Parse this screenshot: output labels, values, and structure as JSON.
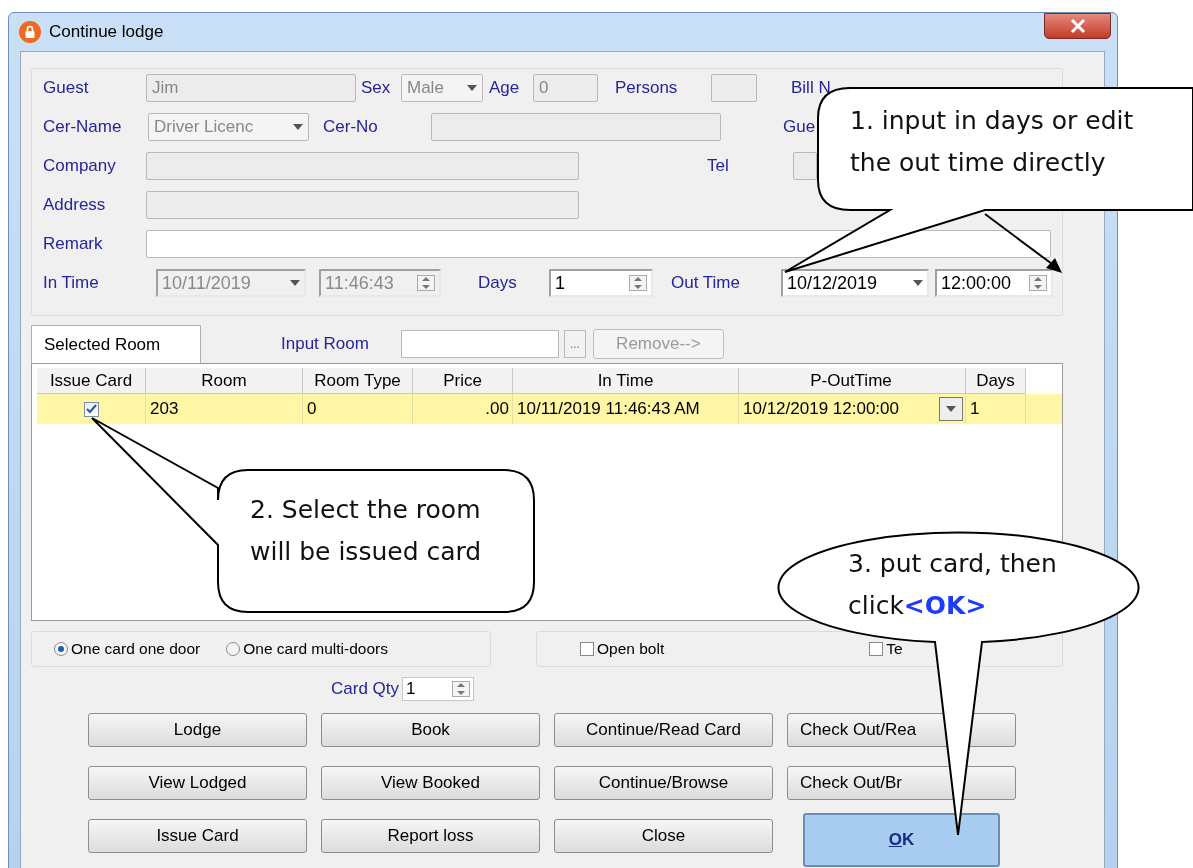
{
  "window": {
    "title": "Continue lodge"
  },
  "guest_info": {
    "guest": {
      "label": "Guest",
      "value": "Jim"
    },
    "sex": {
      "label": "Sex",
      "value": "Male"
    },
    "age": {
      "label": "Age",
      "value": "0"
    },
    "persons": {
      "label": "Persons"
    },
    "bill_no": {
      "label": "Bill N"
    },
    "cer_name": {
      "label": "Cer-Name",
      "value": "Driver Licenc"
    },
    "cer_no": {
      "label": "Cer-No"
    },
    "guest_2": {
      "label": "Gue"
    },
    "company": {
      "label": "Company"
    },
    "tel": {
      "label": "Tel"
    },
    "address": {
      "label": "Address"
    },
    "remark": {
      "label": "Remark"
    },
    "in_time": {
      "label": "In Time",
      "date": "10/11/2019",
      "time": "11:46:43"
    },
    "days": {
      "label": "Days",
      "value": "1"
    },
    "out_time": {
      "label": "Out Time",
      "date": "10/12/2019",
      "time": "12:00:00"
    }
  },
  "room_panel": {
    "tabs": [
      {
        "label": "Selected Room",
        "selected": true
      }
    ],
    "input_room": {
      "label": "Input Room"
    },
    "browse_button": "...",
    "remove_button": {
      "label": "Remove-->",
      "disabled": true
    },
    "table": {
      "columns": [
        "Issue Card",
        "Room",
        "Room Type",
        "Price",
        "In Time",
        "P-OutTime",
        "Days"
      ],
      "rows": [
        {
          "issue_card": true,
          "selected": true,
          "cells": [
            "",
            "203",
            "0",
            ".00",
            "10/11/2019 11:46:43 AM",
            "10/12/2019 12:00:00",
            "1"
          ]
        }
      ]
    }
  },
  "card_mode": [
    {
      "label": "One card one door",
      "selected": true
    },
    {
      "label": "One card multi-doors",
      "selected": false
    }
  ],
  "options": [
    {
      "label": "Open bolt",
      "checked": false
    },
    {
      "label": "Te",
      "checked": false
    }
  ],
  "card_qty": {
    "label": "Card Qty",
    "value": "1"
  },
  "buttons": [
    {
      "label": "Lodge",
      "kind": "normal"
    },
    {
      "label": "Book",
      "kind": "normal"
    },
    {
      "label": "Continue/Read Card",
      "kind": "normal"
    },
    {
      "label": "Check Out/Rea",
      "kind": "covered"
    },
    {
      "label": "View Lodged",
      "kind": "normal"
    },
    {
      "label": "View Booked",
      "kind": "normal"
    },
    {
      "label": "Continue/Browse",
      "kind": "normal"
    },
    {
      "label": "Check Out/Br",
      "kind": "covered"
    },
    {
      "label": "Issue Card",
      "kind": "normal"
    },
    {
      "label": "Report loss",
      "kind": "normal"
    },
    {
      "label": "Close",
      "kind": "normal"
    },
    {
      "label": "OK",
      "kind": "default"
    }
  ],
  "callouts": [
    {
      "text": "1. input in days or edit the out time directly"
    },
    {
      "text": "2. Select the room will be issued card"
    },
    {
      "text": "3. put card, then click**<OK>**"
    }
  ]
}
